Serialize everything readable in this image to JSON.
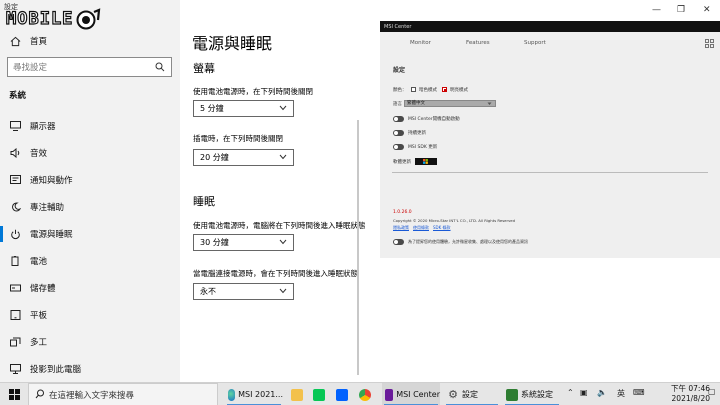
{
  "window": {
    "app_title": "設定",
    "logo_text": "MOBILE"
  },
  "sidebar": {
    "home": "首頁",
    "search_placeholder": "尋找設定",
    "section": "系統",
    "items": [
      {
        "label": "顯示器",
        "icon": "monitor-icon"
      },
      {
        "label": "音效",
        "icon": "speaker-icon"
      },
      {
        "label": "通知與動作",
        "icon": "notification-icon"
      },
      {
        "label": "專注輔助",
        "icon": "moon-icon"
      },
      {
        "label": "電源與睡眠",
        "icon": "power-icon",
        "active": true
      },
      {
        "label": "電池",
        "icon": "battery-icon"
      },
      {
        "label": "儲存體",
        "icon": "storage-icon"
      },
      {
        "label": "平板",
        "icon": "tablet-icon"
      },
      {
        "label": "多工",
        "icon": "multitask-icon"
      },
      {
        "label": "投影到此電腦",
        "icon": "project-icon"
      }
    ]
  },
  "main": {
    "title": "電源與睡眠",
    "screen_heading": "螢幕",
    "screen_battery_label": "使用電池電源時，在下列時間後關閉",
    "screen_battery_value": "5 分鐘",
    "screen_plugged_label": "插電時，在下列時間後關閉",
    "screen_plugged_value": "20 分鐘",
    "sleep_heading": "睡眠",
    "sleep_battery_label": "使用電池電源時，電腦將在下列時間後進入睡眠狀態",
    "sleep_battery_value": "30 分鐘",
    "sleep_plugged_label": "當電腦連接電源時，會在下列時間後進入睡眠狀態",
    "sleep_plugged_value": "永不"
  },
  "msi": {
    "title": "MSI Center",
    "tabs": [
      "Monitor",
      "Features",
      "Support"
    ],
    "settings_title": "設定",
    "color_label": "顏色：",
    "dark_mode": "暗色模式",
    "light_mode": "明亮模式",
    "language_label": "語言",
    "language_value": "繁體中文",
    "autostart": "MSI Center開機自動啟動",
    "auto_update": "持續更新",
    "sdk_update": "MSI SDK 更新",
    "software_update": "軟體更新",
    "version": "1.0.26.0",
    "copyright": "Copyright © 2020 Micro-Star INT'L CO., LTD. All Rights Reserved",
    "links": [
      "隱私政策",
      "使用條款",
      "SDK 條款"
    ],
    "data_consent": "為了提昇您的使用體驗，允許微星收集、處理以及使用您的產品資訊"
  },
  "taskbar": {
    "search_placeholder": "在這裡輸入文字來搜尋",
    "apps": [
      {
        "label": "MSI 2021...",
        "color": "#1a73c7"
      },
      {
        "label": "MSI Center",
        "color": "#6a1b9a"
      },
      {
        "label": "設定",
        "color": "#555555"
      },
      {
        "label": "系統設定",
        "color": "#2e7d32"
      }
    ],
    "ime": "英",
    "time": "下午 07:46",
    "date": "2021/8/20"
  }
}
